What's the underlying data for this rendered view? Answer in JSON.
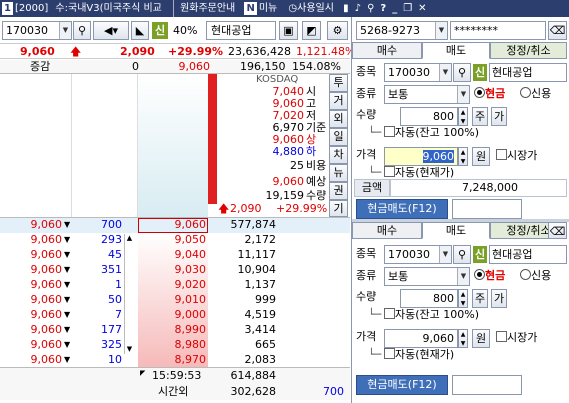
{
  "titlebar": {
    "num": "1",
    "code": "[2000]",
    "title": "수:국내V3(미국주식 비교",
    "menu": "원화주문안내",
    "n": "N",
    "news": "미뉴",
    "sys": "사용일시"
  },
  "toolbar": {
    "stock_code": "170030",
    "sin": "신",
    "margin": "40%",
    "stock_name": "현대공업"
  },
  "price": {
    "current": "9,060",
    "diff": "2,090",
    "rate": "+29.99%",
    "volume": "23,636,428",
    "pct": "1,121.48%"
  },
  "hdr": {
    "label": "증감",
    "zero": "0",
    "cur": "9,060",
    "vol": "196,150",
    "ratio": "154.08%"
  },
  "quote_side": {
    "market": "KOSDAQ",
    "rows": [
      {
        "v": "7,040",
        "k": "시"
      },
      {
        "v": "9,060",
        "k": "고"
      },
      {
        "v": "7,020",
        "k": "저"
      },
      {
        "v": "6,970",
        "k": "기준"
      },
      {
        "v": "9,060",
        "k": "상"
      },
      {
        "v": "4,880",
        "k": "하"
      },
      {
        "v": "25",
        "k": "비용"
      },
      {
        "v": "9,060",
        "k": "예상"
      },
      {
        "v": "19,159",
        "k": "수량"
      }
    ],
    "exp_diff": "2,090",
    "exp_rate": "+29.99%"
  },
  "vtabs": [
    "투",
    "거",
    "외",
    "일",
    "차",
    "뉴",
    "권",
    "기"
  ],
  "bid_rows": [
    {
      "p": "9,060",
      "q": "700",
      "bp": "9,060",
      "bv": "577,874"
    },
    {
      "p": "9,060",
      "q": "293",
      "bp": "9,050",
      "bv": "2,172"
    },
    {
      "p": "9,060",
      "q": "45",
      "bp": "9,040",
      "bv": "11,117"
    },
    {
      "p": "9,060",
      "q": "351",
      "bp": "9,030",
      "bv": "10,904"
    },
    {
      "p": "9,060",
      "q": "1",
      "bp": "9,020",
      "bv": "1,137"
    },
    {
      "p": "9,060",
      "q": "50",
      "bp": "9,010",
      "bv": "999"
    },
    {
      "p": "9,060",
      "q": "7",
      "bp": "9,000",
      "bv": "4,519"
    },
    {
      "p": "9,060",
      "q": "177",
      "bp": "8,990",
      "bv": "3,414"
    },
    {
      "p": "9,060",
      "q": "325",
      "bp": "8,980",
      "bv": "665"
    },
    {
      "p": "9,060",
      "q": "10",
      "bp": "8,970",
      "bv": "2,083"
    }
  ],
  "footer": {
    "time": "15:59:53",
    "total": "614,884",
    "after_label": "시간외",
    "after_val": "302,628",
    "qty": "700"
  },
  "account": {
    "no": "5268-9273",
    "pw": "********"
  },
  "panel1": {
    "tabs": [
      "매수",
      "매도",
      "정정/취소"
    ],
    "active": 1,
    "code_label": "종목",
    "code": "170030",
    "sin": "신",
    "name": "현대공업",
    "type_label": "종류",
    "type": "보통",
    "cash": "현금",
    "credit": "신용",
    "qty_label": "수량",
    "qty": "800",
    "ju": "주",
    "ga": "가",
    "auto1": "자동(잔고 100%)",
    "price_label": "가격",
    "price": "9,060",
    "won": "원",
    "market": "시장가",
    "auto2": "자동(현재가)",
    "amount_label": "금액",
    "amount": "7,248,000",
    "submit": "현금매도(F12)"
  },
  "panel2": {
    "tabs": [
      "매수",
      "매도",
      "정정/취소"
    ],
    "active": 1,
    "code_label": "종목",
    "code": "170030",
    "sin": "신",
    "name": "현대공업",
    "type_label": "종류",
    "type": "보통",
    "cash": "현금",
    "credit": "신용",
    "qty_label": "수량",
    "qty": "800",
    "ju": "주",
    "ga": "가",
    "auto1": "자동(잔고 100%)",
    "price_label": "가격",
    "price": "9,060",
    "won": "원",
    "market": "시장가",
    "auto2": "자동(현재가)",
    "submit": "현금매도(F12)"
  }
}
